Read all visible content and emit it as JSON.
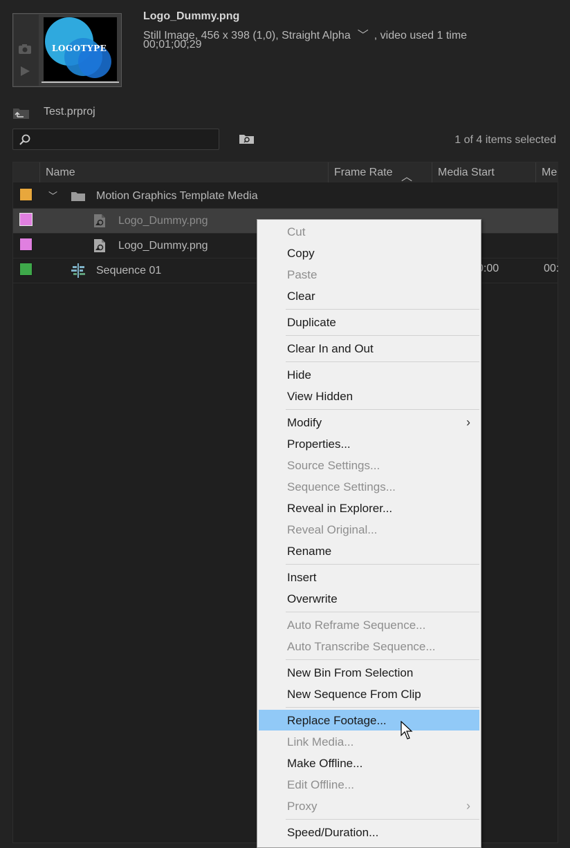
{
  "header": {
    "clip_name": "Logo_Dummy.png",
    "clip_info_before": "Still Image, 456 x 398 (1,0), Straight Alpha",
    "clip_info_chevron": "﹀",
    "clip_info_after": ", video used 1 time",
    "clip_duration": "00;01;00;29",
    "thumbnail_text": "LOGOTYPE"
  },
  "project": {
    "name": "Test.prproj",
    "search_placeholder": "",
    "selection_count": "1 of 4 items selected"
  },
  "columns": {
    "name": "Name",
    "frame_rate": "Frame Rate",
    "sort_glyph": "︿",
    "media_start": "Media Start",
    "media_end_partial": "Me"
  },
  "rows": [
    {
      "name": "Motion Graphics Template Media",
      "color": "#e8a73c",
      "expander": "﹀"
    },
    {
      "name": "Logo_Dummy.png",
      "color": "#e07fe0"
    },
    {
      "name": "Logo_Dummy.png",
      "color": "#e07fe0"
    },
    {
      "name": "Sequence 01",
      "color": "#3ea84a",
      "media_start_partial": "0:00",
      "media_end_partial": "00:"
    }
  ],
  "menu": {
    "items": [
      {
        "label": "Cut",
        "enabled": false
      },
      {
        "label": "Copy",
        "enabled": true
      },
      {
        "label": "Paste",
        "enabled": false
      },
      {
        "label": "Clear",
        "enabled": true
      },
      {
        "label": "Duplicate",
        "enabled": true
      },
      {
        "label": "Clear In and Out",
        "enabled": true
      },
      {
        "label": "Hide",
        "enabled": true
      },
      {
        "label": "View Hidden",
        "enabled": true
      },
      {
        "label": "Modify",
        "enabled": true,
        "submenu": true
      },
      {
        "label": "Properties...",
        "enabled": true
      },
      {
        "label": "Source Settings...",
        "enabled": false
      },
      {
        "label": "Sequence Settings...",
        "enabled": false
      },
      {
        "label": "Reveal in Explorer...",
        "enabled": true
      },
      {
        "label": "Reveal Original...",
        "enabled": false
      },
      {
        "label": "Rename",
        "enabled": true
      },
      {
        "label": "Insert",
        "enabled": true
      },
      {
        "label": "Overwrite",
        "enabled": true
      },
      {
        "label": "Auto Reframe Sequence...",
        "enabled": false
      },
      {
        "label": "Auto Transcribe Sequence...",
        "enabled": false
      },
      {
        "label": "New Bin From Selection",
        "enabled": true
      },
      {
        "label": "New Sequence From Clip",
        "enabled": true
      },
      {
        "label": "Replace Footage...",
        "enabled": true,
        "highlighted": true
      },
      {
        "label": "Link Media...",
        "enabled": false
      },
      {
        "label": "Make Offline...",
        "enabled": true
      },
      {
        "label": "Edit Offline...",
        "enabled": false
      },
      {
        "label": "Proxy",
        "enabled": false,
        "submenu": true
      },
      {
        "label": "Speed/Duration...",
        "enabled": true
      }
    ],
    "submenu_glyph": "›",
    "highlight_color": "#91c9f7"
  }
}
